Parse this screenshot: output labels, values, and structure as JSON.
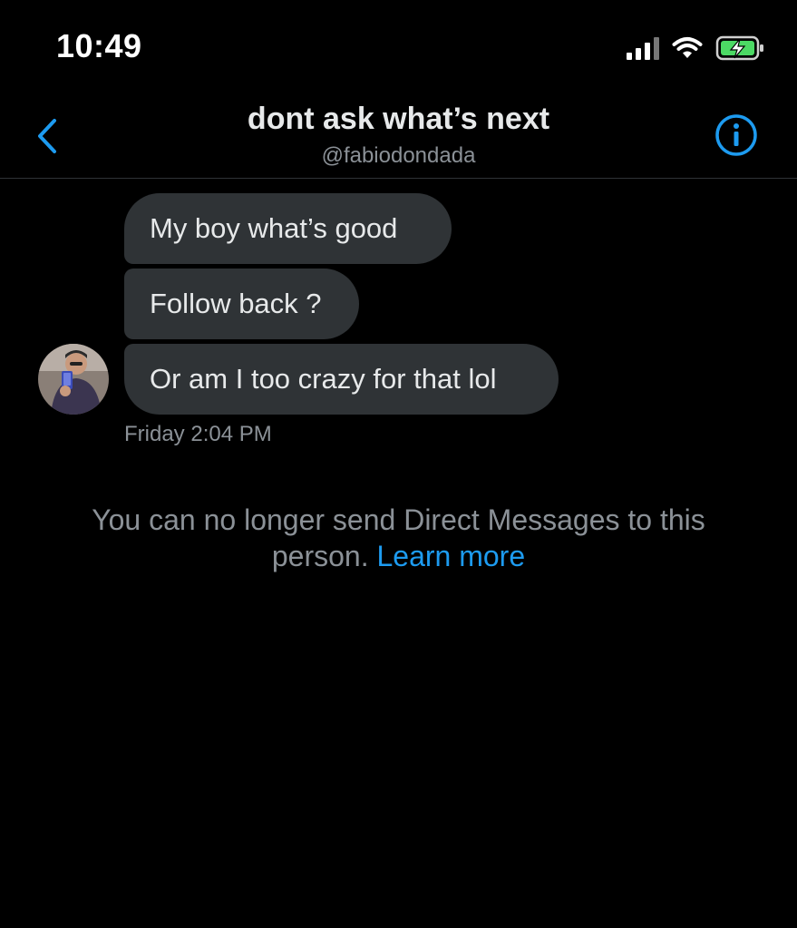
{
  "status_bar": {
    "time": "10:49",
    "icons": [
      "signal-icon",
      "wifi-icon",
      "battery-charging-icon"
    ]
  },
  "header": {
    "title": "dont ask what’s next",
    "handle": "@fabiodondada",
    "back_icon": "chevron-left-icon",
    "info_icon": "info-icon"
  },
  "messages": [
    {
      "text": "My boy what’s good"
    },
    {
      "text": "Follow back ?"
    },
    {
      "text": "Or am I too crazy for that lol"
    }
  ],
  "timestamp": "Friday 2:04 PM",
  "notice": {
    "text_line1": "You can no longer send Direct Messages to this",
    "text_line2": "person.",
    "link": "Learn more"
  },
  "colors": {
    "background": "#000000",
    "bubble": "#2f3336",
    "accent": "#1d9bf0",
    "secondary_text": "#8b9197",
    "battery_charging": "#4cd964"
  }
}
